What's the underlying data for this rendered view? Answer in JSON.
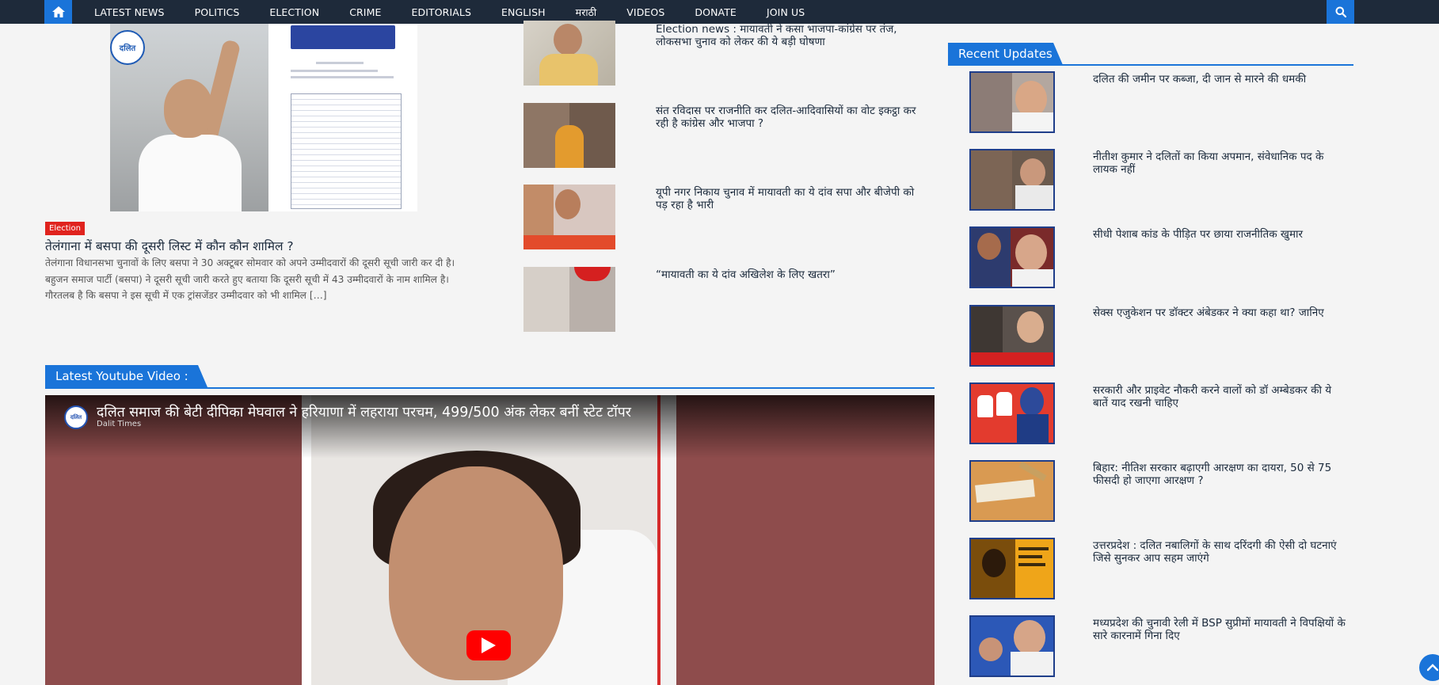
{
  "nav": {
    "items": [
      "LATEST NEWS",
      "POLITICS",
      "ELECTION",
      "CRIME",
      "EDITORIALS",
      "ENGLISH",
      "मराठी",
      "VIDEOS",
      "DONATE",
      "JOIN US"
    ]
  },
  "featured": {
    "logo_text": "दलित",
    "tag": "Election",
    "title": "तेलंगाना में बसपा की दूसरी लिस्ट में कौन कौन शामिल ?",
    "excerpt": "तेलंगाना  विधानसभा चुनावों के लिए बसपा ने 30 अक्टूबर सोमवार को अपने उम्मीदवारों की दूसरी सूची जारी कर दी है। बहुजन समाज पार्टी (बसपा) ने दूसरी सूची जारी करते हुए बताया कि दूसरी सूची में 43 उम्मीदवारों के नाम शामिल है। गौरतलब है कि बसपा ने इस सूची में एक ट्रांसजेंडर उम्मीदवार को भी शामिल […]"
  },
  "middle": [
    {
      "title": "Election news :  मायावती ने कसा भाजपा-कांग्रेस पर तंज, लोकसभा चुनाव को लेकर की ये बड़ी घोषणा"
    },
    {
      "title": "संत रविदास पर राजनीति कर दलित-आदिवासियों का वोट इकट्ठा कर रही है कांग्रेस और भाजपा ?"
    },
    {
      "title": "यूपी नगर निकाय चुनाव में मायावती का ये दांव सपा और बीजेपी को पड़ रहा है भारी"
    },
    {
      "title": "“मायावती का ये दांव अखिलेश के लिए खतरा”"
    }
  ],
  "recent": {
    "heading": "Recent Updates",
    "items": [
      {
        "title": "दलित की जमीन पर कब्जा, दी जान से मारने की धमकी"
      },
      {
        "title": "नीतीश कुमार ने दलितों का किया अपमान, संवेधानिक पद के लायक नहीं"
      },
      {
        "title": " सीधी पेशाब कांड के पीड़ित पर छाया राजनीतिक खुमार"
      },
      {
        "title": "सेक्स एजुकेशन पर डॉक्टर अंबेडकर ने क्या कहा था? जानिए"
      },
      {
        "title": "सरकारी और प्राइवेट नौकरी करने वालों को डॉ अम्बेडकर की ये बातें याद रखनी चाहिए"
      },
      {
        "title": "बिहार: नीतिश सरकार बढ़ाएगी आरक्षण का दायरा, 50 से 75 फीसदी हो जाएगा आरक्षण ?"
      },
      {
        "title": "उत्तरप्रदेश : दलित नबालिगों के साथ दरिंदगी की ऐसी दो घटनाएं जिसे सुनकर आप सहम जाएंगे"
      },
      {
        "title": "मध्यप्रदेश की चुनावी रेली में BSP सुप्रीमों मायावती ने विपक्षियों के सारे कारनामें गिना दिए"
      }
    ]
  },
  "youtube": {
    "heading": "Latest Youtube Video :",
    "title": "दलित समाज की बेटी दीपिका मेघवाल ने हरियाणा में लहराया परचम, 499/500 अंक लेकर बनीं स्टेट टॉपर",
    "channel": "Dalit Times",
    "avatar_text": "दलित"
  },
  "icons": {
    "home": "home-icon",
    "search": "search-icon",
    "play": "play-icon",
    "scroll_top": "chevron-up-icon"
  },
  "colors": {
    "nav_bg": "#1e2a3a",
    "accent": "#1a74d9",
    "tag_red": "#e0231e",
    "youtube_red": "#ff0000"
  }
}
